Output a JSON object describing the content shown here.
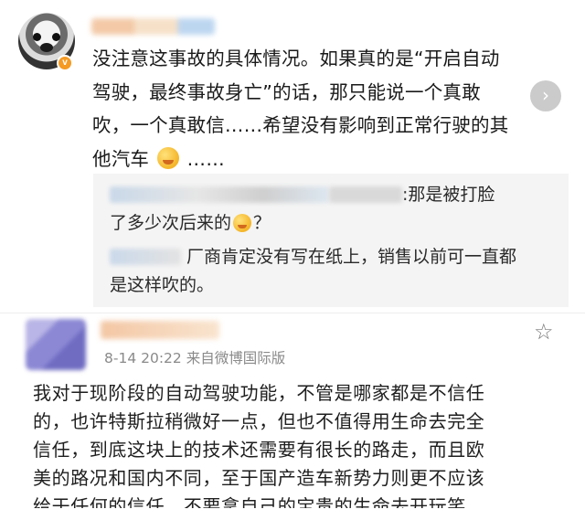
{
  "comment1": {
    "badge": "v",
    "lines": [
      "没注意这事故的具体情况。如果真的是“开启自动",
      "驾驶，最终事故身亡”的话，那只能说一个真敢",
      "吹，一个真敢信……希望没有影响到正常行驶的其",
      "他汽车"
    ],
    "tail": "……",
    "emoji_icon": "laughing-face-emoji",
    "next_icon": "chevron-right-icon"
  },
  "replies": [
    {
      "text_a": ":那是被打脸",
      "text_b": "了多少次后来的",
      "text_c": "？"
    },
    {
      "text_a": "厂商肯定没有写在纸上，销售以前可一直都",
      "text_b": "是这样吹的。"
    }
  ],
  "comment2": {
    "timestamp": "8-14 20:22",
    "source": "来自微博国际版",
    "star_icon": "star-outline-icon",
    "lines": [
      "我对于现阶段的自动驾驶功能，不管是哪家都是不信任",
      "的，也许特斯拉稍微好一点，但也不值得用生命去完全",
      "信任，到底这块上的技术还需要有很长的路走，而且欧",
      "美的路况和国内不同，至于国产造车新势力则更不应该",
      "给于任何的信任，不要拿自己的宝贵的生命去开玩笑。"
    ]
  }
}
